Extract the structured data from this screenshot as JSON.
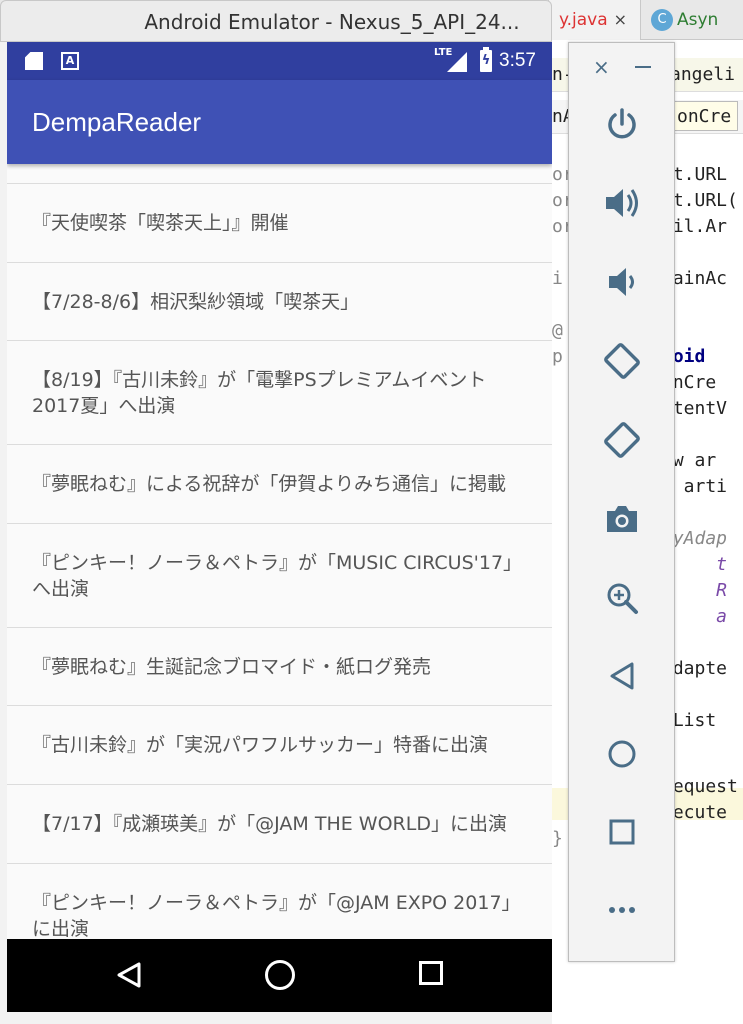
{
  "ide": {
    "tabs": [
      {
        "label": "y.java",
        "close": "×"
      },
      {
        "label": "Asyn",
        "icon": "C"
      }
    ],
    "crumbs": [
      "n-",
      "angeli",
      "nA",
      "onCre"
    ],
    "code_lines": [
      {
        "left": "or",
        "right": "et.URL"
      },
      {
        "left": "or",
        "right": "et.URL("
      },
      {
        "left": "or",
        "right": "til.Ar"
      },
      {
        "left": "",
        "right": ""
      },
      {
        "left": "i",
        "right": "MainAc"
      },
      {
        "left": "",
        "right": ""
      },
      {
        "left": "@",
        "right": ""
      },
      {
        "left": "p",
        "right": "void"
      },
      {
        "left": "",
        "right": "onCre"
      },
      {
        "left": "",
        "right": "ntentV"
      },
      {
        "left": "",
        "right": ""
      },
      {
        "left": "",
        "right": "ew ar"
      },
      {
        "left": "",
        "right": "g arti"
      },
      {
        "left": "",
        "right": ""
      },
      {
        "left": "",
        "right": "ayAdap"
      },
      {
        "left": "",
        "right": "     t"
      },
      {
        "left": "",
        "right": "     R"
      },
      {
        "left": "",
        "right": "     a"
      },
      {
        "left": "",
        "right": ""
      },
      {
        "left": "",
        "right": "Adapte"
      },
      {
        "left": "",
        "right": ""
      },
      {
        "left": "",
        "right": "eList"
      },
      {
        "left": "",
        "right": ""
      },
      {
        "left": "",
        "right": "Request"
      },
      {
        "left": "",
        "right": "xecute"
      },
      {
        "left": "}",
        "right": ""
      }
    ]
  },
  "emulator": {
    "window_title": "Android Emulator - Nexus_5_API_24...",
    "status_bar": {
      "network": "LTE",
      "time": "3:57",
      "bg": "#303f9f"
    },
    "app_bar": {
      "title": "DempaReader",
      "bg": "#3f51b5"
    },
    "articles": [
      "",
      "『天使喫茶「喫茶天上」』開催",
      "【7/28-8/6】相沢梨紗領域「喫茶天」",
      "【8/19】『古川未鈴』が「電撃PSプレミアムイベント2017夏」へ出演",
      "『夢眠ねむ』による祝辞が「伊賀よりみち通信」に掲載",
      "『ピンキー！ノーラ＆ペトラ』が「MUSIC CIRCUS'17」へ出演",
      "『夢眠ねむ』生誕記念ブロマイド・紙ログ発売",
      "『古川未鈴』が「実況パワフルサッカー」特番に出演",
      "【7/17】『成瀬瑛美』が「@JAM THE WORLD」に出演",
      "『ピンキー！ノーラ＆ペトラ』が「@JAM EXPO 2017」に出演"
    ],
    "nav_bar": {
      "back": "back-icon",
      "home": "home-icon",
      "recent": "recents-icon"
    }
  },
  "toolbar": {
    "close_label": "×",
    "buttons": [
      {
        "name": "power-button",
        "icon": "power-icon"
      },
      {
        "name": "volume-up-button",
        "icon": "volume-up-icon"
      },
      {
        "name": "volume-down-button",
        "icon": "volume-down-icon"
      },
      {
        "name": "rotate-left-button",
        "icon": "rotate-left-icon"
      },
      {
        "name": "rotate-right-button",
        "icon": "rotate-right-icon"
      },
      {
        "name": "screenshot-button",
        "icon": "camera-icon"
      },
      {
        "name": "zoom-button",
        "icon": "zoom-in-icon"
      },
      {
        "name": "back-button",
        "icon": "back-icon"
      },
      {
        "name": "home-button",
        "icon": "home-icon"
      },
      {
        "name": "overview-button",
        "icon": "overview-icon"
      },
      {
        "name": "more-button",
        "icon": "more-icon"
      }
    ],
    "icon_color": "#4a6d87"
  }
}
